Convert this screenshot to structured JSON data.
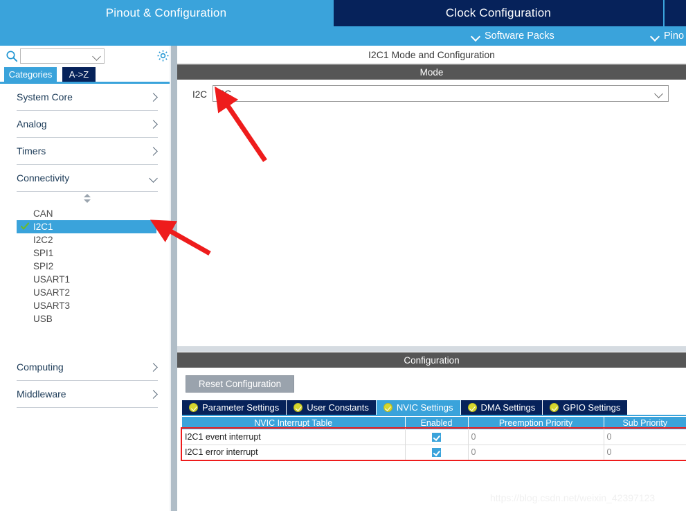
{
  "header": {
    "tabs": [
      {
        "label": "Pinout & Configuration",
        "active": true
      },
      {
        "label": "Clock Configuration",
        "active": false
      },
      {
        "label": "",
        "active": false
      }
    ],
    "sub_items": [
      {
        "label": "Software Packs",
        "icon": "chevron-down-icon"
      },
      {
        "label": "Pino",
        "icon": "chevron-down-icon"
      }
    ]
  },
  "sidebar": {
    "search": {
      "value": "",
      "placeholder": "",
      "icon": "search-icon"
    },
    "settings_icon": "gear-icon",
    "view_tabs": [
      {
        "label": "Categories",
        "selected": true
      },
      {
        "label": "A->Z",
        "selected": false
      }
    ],
    "categories": [
      {
        "label": "System Core",
        "expanded": false
      },
      {
        "label": "Analog",
        "expanded": false
      },
      {
        "label": "Timers",
        "expanded": false
      },
      {
        "label": "Connectivity",
        "expanded": true
      }
    ],
    "peripherals": [
      {
        "label": "CAN",
        "selected": false,
        "configured": false
      },
      {
        "label": "I2C1",
        "selected": true,
        "configured": true
      },
      {
        "label": "I2C2",
        "selected": false,
        "configured": false
      },
      {
        "label": "SPI1",
        "selected": false,
        "configured": false
      },
      {
        "label": "SPI2",
        "selected": false,
        "configured": false
      },
      {
        "label": "USART1",
        "selected": false,
        "configured": false
      },
      {
        "label": "USART2",
        "selected": false,
        "configured": false
      },
      {
        "label": "USART3",
        "selected": false,
        "configured": false
      },
      {
        "label": "USB",
        "selected": false,
        "configured": false
      }
    ],
    "categories_bottom": [
      {
        "label": "Computing",
        "expanded": false
      },
      {
        "label": "Middleware",
        "expanded": false
      }
    ]
  },
  "main": {
    "panel_title": "I2C1 Mode and Configuration",
    "mode_band": "Mode",
    "mode": {
      "label": "I2C",
      "selected_value": "I2C",
      "caret": "chevron-down-icon"
    },
    "config_band": "Configuration",
    "reset_button": "Reset Configuration",
    "config_tabs": [
      {
        "label": "Parameter Settings",
        "active": false
      },
      {
        "label": "User Constants",
        "active": false
      },
      {
        "label": "NVIC Settings",
        "active": true
      },
      {
        "label": "DMA Settings",
        "active": false
      },
      {
        "label": "GPIO Settings",
        "active": false
      }
    ],
    "nvic_table": {
      "columns": [
        "NVIC Interrupt Table",
        "Enabled",
        "Preemption Priority",
        "Sub Priority"
      ],
      "rows": [
        {
          "name": "I2C1 event interrupt",
          "enabled": true,
          "preemption_priority": "0",
          "sub_priority": "0"
        },
        {
          "name": "I2C1 error interrupt",
          "enabled": true,
          "preemption_priority": "0",
          "sub_priority": "0"
        }
      ]
    }
  },
  "watermark": "https://blog.csdn.net/weixin_42397123",
  "colors": {
    "accent_light_blue": "#3aa3db",
    "dark_navy": "#06225a",
    "band_gray": "#565656",
    "annotation_red": "#ee1c1c",
    "check_green": "#6aba2c"
  }
}
